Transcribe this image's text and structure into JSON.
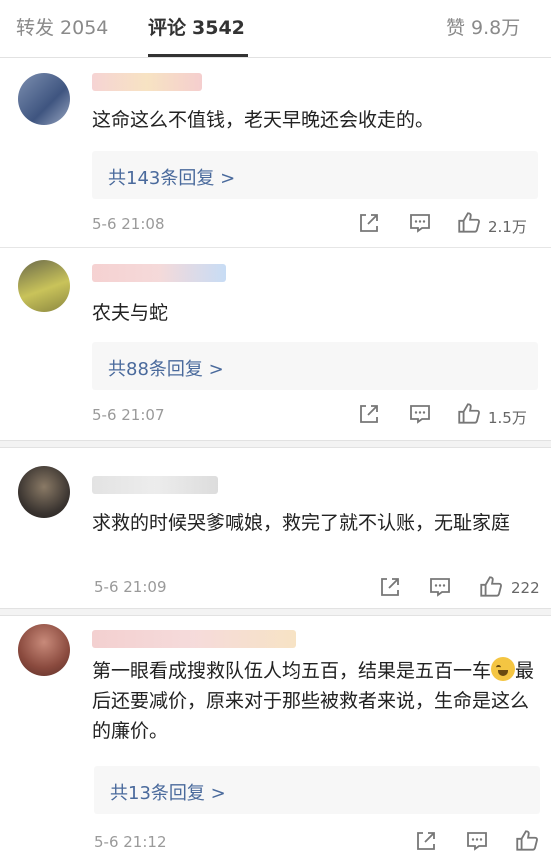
{
  "tabs": {
    "repost": {
      "label": "转发",
      "count": "2054"
    },
    "comment": {
      "label": "评论",
      "count": "3542"
    },
    "like": {
      "label": "赞",
      "count": "9.8万"
    }
  },
  "comments": [
    {
      "text": "这命这么不值钱，老天早晚还会收走的。",
      "reply": "共143条回复 >",
      "time": "5-6 21:08",
      "likes": "2.1万"
    },
    {
      "text": "农夫与蛇",
      "reply": "共88条回复 >",
      "time": "5-6 21:07",
      "likes": "1.5万"
    },
    {
      "text": "求救的时候哭爹喊娘，救完了就不认账，无耻家庭",
      "reply": "",
      "time": "5-6 21:09",
      "likes": "222"
    },
    {
      "text_a": "第一眼看成搜救队伍人均五百，结果是五百一车",
      "text_b": "最后还要减价，原来对于那些被救者来说，生命是这么的廉价。",
      "reply": "共13条回复 >",
      "time": "5-6 21:12",
      "likes": ""
    }
  ]
}
